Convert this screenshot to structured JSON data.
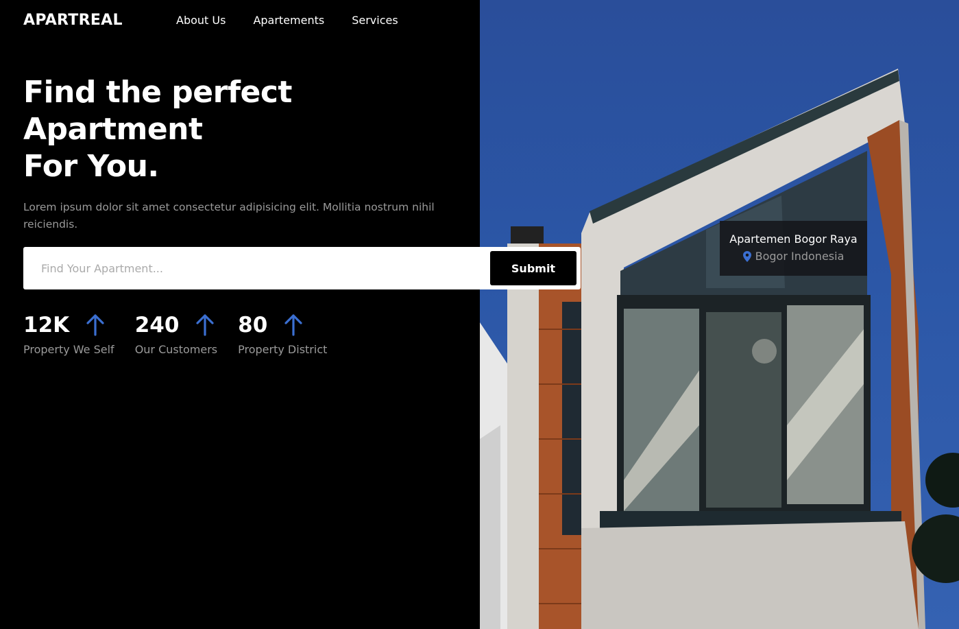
{
  "brand": {
    "logo": "APARTREAL"
  },
  "nav": {
    "items": [
      "About Us",
      "Apartements",
      "Services"
    ]
  },
  "hero": {
    "headline_lines": [
      "Find the perfect",
      "Apartment",
      "For You."
    ],
    "description": "Lorem ipsum dolor sit amet consectetur adipisicing elit. Mollitia nostrum nihil reiciendis."
  },
  "search": {
    "placeholder": "Find Your Apartment...",
    "value": "",
    "submit_label": "Submit"
  },
  "stats": [
    {
      "value": "12K",
      "label": "Property We Self",
      "icon": "arrow-up-icon"
    },
    {
      "value": "240",
      "label": "Our Customers",
      "icon": "arrow-up-icon"
    },
    {
      "value": "80",
      "label": "Property District",
      "icon": "arrow-up-icon"
    }
  ],
  "location_card": {
    "title": "Apartemen Bogor Raya",
    "subtitle": "Bogor Indonesia",
    "icon": "map-pin-icon"
  },
  "colors": {
    "accent": "#3b6fd1",
    "background": "#000000",
    "muted": "#9a9a9a"
  }
}
